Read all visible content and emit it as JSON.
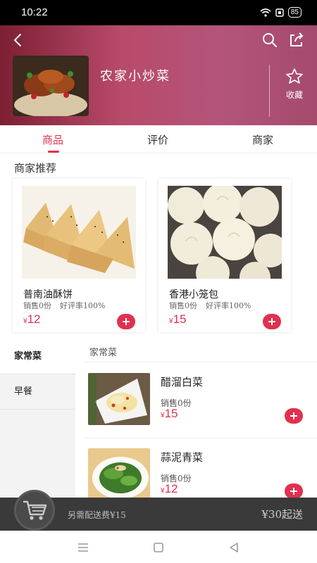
{
  "status": {
    "time": "10:22",
    "battery": "85"
  },
  "shop": {
    "name": "农家小炒菜",
    "favorite_label": "收藏"
  },
  "tabs": [
    {
      "label": "商品"
    },
    {
      "label": "评价"
    },
    {
      "label": "商家"
    }
  ],
  "recommend": {
    "title": "商家推荐",
    "items": [
      {
        "name": "普南油酥饼",
        "sales": "销售0份",
        "rating": "好评率100%",
        "currency": "¥",
        "price": "12"
      },
      {
        "name": "香港小笼包",
        "sales": "销售0份",
        "rating": "好评率100%",
        "currency": "¥",
        "price": "15"
      }
    ]
  },
  "categories": [
    {
      "label": "家常菜"
    },
    {
      "label": "早餐"
    }
  ],
  "section": {
    "title": "家常菜"
  },
  "menu_items": [
    {
      "name": "醋溜白菜",
      "sales": "销售0份",
      "currency": "¥",
      "price": "15"
    },
    {
      "name": "蒜泥青菜",
      "sales": "销售0份",
      "currency": "¥",
      "price": "12"
    }
  ],
  "cart": {
    "delivery_note": "另需配送费¥15",
    "min_order": "¥30起送"
  },
  "colors": {
    "accent": "#e0314f",
    "header_start": "#7c1f33",
    "header_end": "#a44a6c",
    "cart_bar": "#3a3a3a"
  }
}
